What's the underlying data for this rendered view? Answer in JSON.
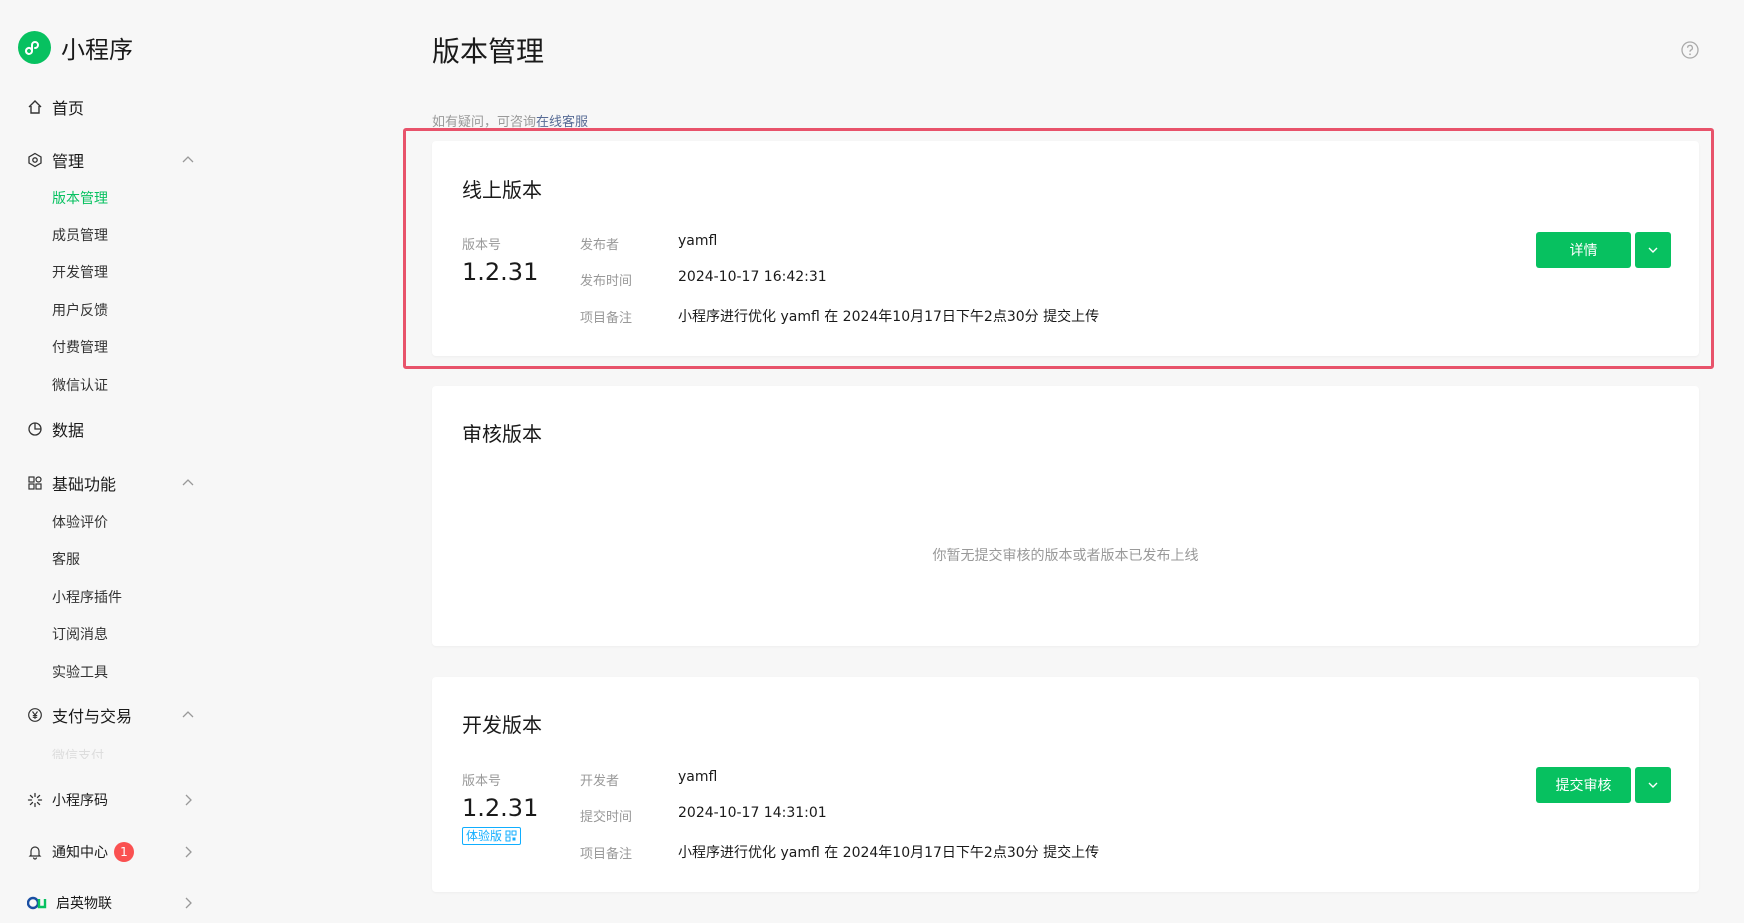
{
  "app": {
    "title": "小程序"
  },
  "nav": {
    "home": "首页",
    "manage": "管理",
    "manage_items": [
      "版本管理",
      "成员管理",
      "开发管理",
      "用户反馈",
      "付费管理",
      "微信认证"
    ],
    "data": "数据",
    "basic": "基础功能",
    "basic_items": [
      "体验评价",
      "客服",
      "小程序插件",
      "订阅消息",
      "实验工具"
    ],
    "pay": "支付与交易",
    "pay_faded": "微信支付",
    "qrcode": "小程序码",
    "notify": "通知中心",
    "notify_badge": "1",
    "qiying": "启英物联"
  },
  "page": {
    "title": "版本管理",
    "hint_prefix": "如有疑问，可咨询",
    "hint_link": "在线客服"
  },
  "online": {
    "title": "线上版本",
    "version_label": "版本号",
    "version": "1.2.31",
    "publisher_label": "发布者",
    "publisher": "yamfl",
    "time_label": "发布时间",
    "time": "2024-10-17 16:42:31",
    "note_label": "项目备注",
    "note": "小程序进行优化 yamfl 在 2024年10月17日下午2点30分 提交上传",
    "button": "详情"
  },
  "review": {
    "title": "审核版本",
    "empty": "你暂无提交审核的版本或者版本已发布上线"
  },
  "dev": {
    "title": "开发版本",
    "version_label": "版本号",
    "version": "1.2.31",
    "tag": "体验版",
    "developer_label": "开发者",
    "developer": "yamfl",
    "time_label": "提交时间",
    "time": "2024-10-17 14:31:01",
    "note_label": "项目备注",
    "note": "小程序进行优化 yamfl 在 2024年10月17日下午2点30分 提交上传",
    "button": "提交审核"
  },
  "colors": {
    "accent": "#07c160",
    "link": "#576b95",
    "highlight": "#e8536b",
    "badge": "#fa5151",
    "tag": "#10aeff"
  }
}
